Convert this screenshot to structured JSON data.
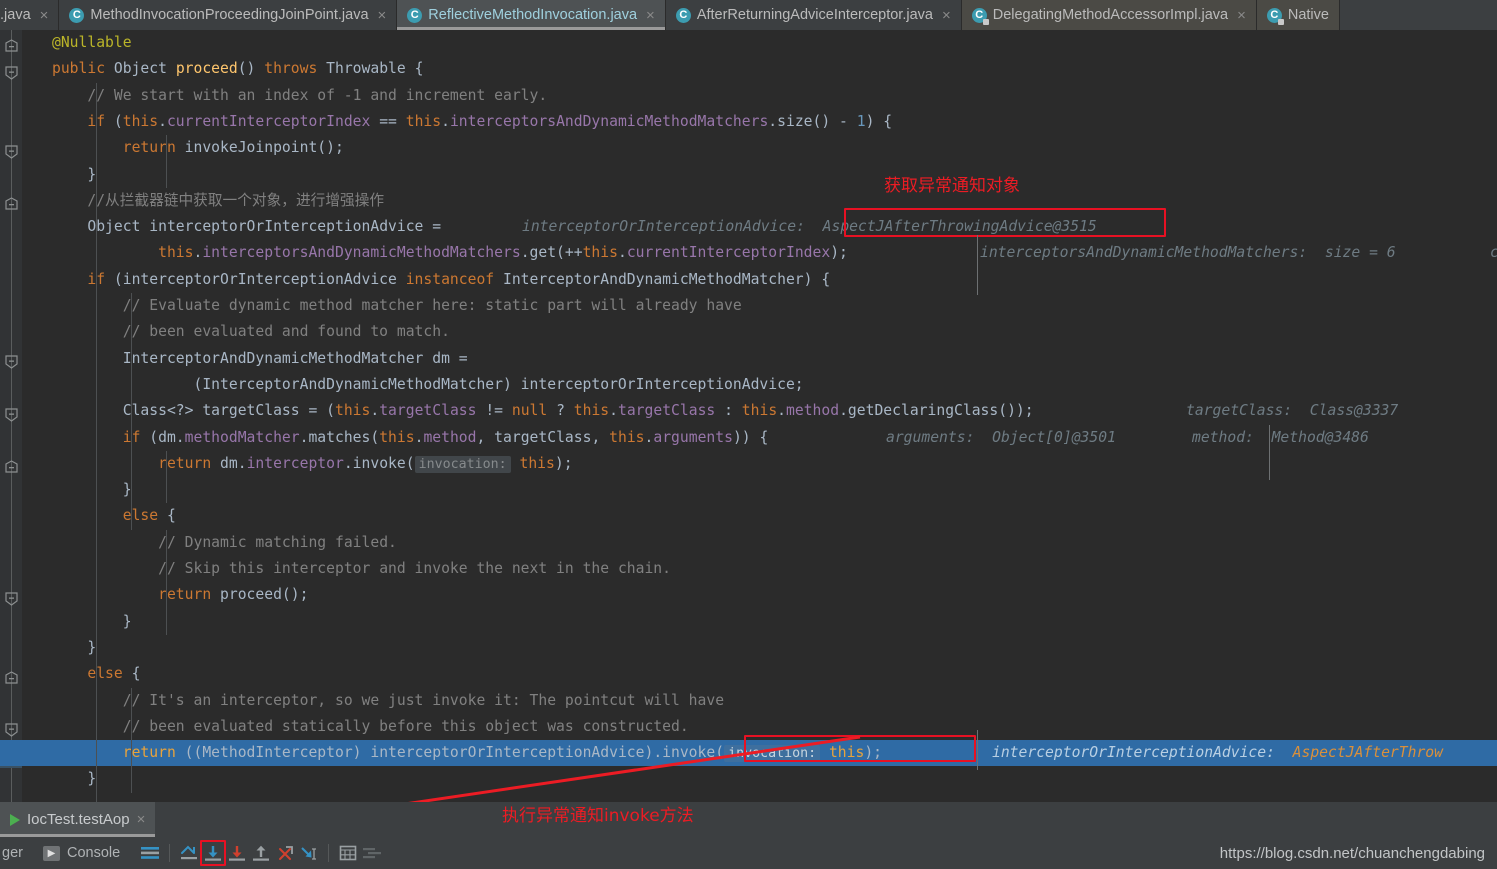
{
  "window": {
    "app": "IntelliJ IDEA Debugger",
    "watermark": "https://blog.csdn.net/chuanchengdabing"
  },
  "tabbar": {
    "tabs": [
      {
        "label": ".java",
        "icon": "",
        "state": "truncated",
        "closable": true
      },
      {
        "label": "MethodInvocationProceedingJoinPoint.java",
        "icon": "class-icon",
        "state": "normal",
        "closable": true
      },
      {
        "label": "ReflectiveMethodInvocation.java",
        "icon": "class-icon",
        "state": "active",
        "closable": true
      },
      {
        "label": "AfterReturningAdviceInterceptor.java",
        "icon": "class-icon",
        "state": "normal",
        "closable": true
      },
      {
        "label": "DelegatingMethodAccessorImpl.java",
        "icon": "class-icon-locked",
        "state": "readonly",
        "closable": true
      },
      {
        "label": "Native",
        "icon": "class-icon-locked",
        "state": "readonly",
        "closable": false
      }
    ],
    "close_glyph": "×"
  },
  "editor": {
    "language": "java",
    "lines": [
      {
        "n": 1,
        "indent": 0,
        "segments": [
          {
            "t": "@Nullable",
            "c": "ann"
          }
        ]
      },
      {
        "n": 2,
        "indent": 0,
        "segments": [
          {
            "t": "public",
            "c": "kw"
          },
          {
            "t": " ",
            "c": "id"
          },
          {
            "t": "Object",
            "c": "type"
          },
          {
            "t": " ",
            "c": "id"
          },
          {
            "t": "proceed",
            "c": "fn"
          },
          {
            "t": "() ",
            "c": "id"
          },
          {
            "t": "throws",
            "c": "kw"
          },
          {
            "t": " Throwable {",
            "c": "id"
          }
        ]
      },
      {
        "n": 3,
        "indent": 1,
        "segments": [
          {
            "t": "// We start with an index of -1 and increment early.",
            "c": "cmt"
          }
        ]
      },
      {
        "n": 4,
        "indent": 1,
        "segments": [
          {
            "t": "if",
            "c": "kw"
          },
          {
            "t": " (",
            "c": "id"
          },
          {
            "t": "this",
            "c": "kw"
          },
          {
            "t": ".",
            "c": "id"
          },
          {
            "t": "currentInterceptorIndex",
            "c": "fld"
          },
          {
            "t": " == ",
            "c": "id"
          },
          {
            "t": "this",
            "c": "kw"
          },
          {
            "t": ".",
            "c": "id"
          },
          {
            "t": "interceptorsAndDynamicMethodMatchers",
            "c": "fld"
          },
          {
            "t": ".size() - ",
            "c": "id"
          },
          {
            "t": "1",
            "c": "num"
          },
          {
            "t": ") {",
            "c": "id"
          }
        ]
      },
      {
        "n": 5,
        "indent": 2,
        "segments": [
          {
            "t": "return",
            "c": "kw"
          },
          {
            "t": " invokeJoinpoint();",
            "c": "id"
          }
        ]
      },
      {
        "n": 6,
        "indent": 1,
        "segments": [
          {
            "t": "}",
            "c": "id"
          }
        ]
      },
      {
        "n": 7,
        "indent": 1,
        "segments": [
          {
            "t": "//从拦截器链中获取一个对象，进行增强操作",
            "c": "cmt"
          }
        ]
      },
      {
        "n": 8,
        "indent": 1,
        "segments": [
          {
            "t": "Object",
            "c": "type"
          },
          {
            "t": " interceptorOrInterceptionAdvice =",
            "c": "id"
          }
        ],
        "inline_hints": [
          {
            "label": "interceptorOrInterceptionAdvice:",
            "value": "AspectJAfterThrowingAdvice@3515",
            "boxed": true
          }
        ]
      },
      {
        "n": 9,
        "indent": 3,
        "segments": [
          {
            "t": "this",
            "c": "kw"
          },
          {
            "t": ".",
            "c": "id"
          },
          {
            "t": "interceptorsAndDynamicMethodMatchers",
            "c": "fld"
          },
          {
            "t": ".get(++",
            "c": "id"
          },
          {
            "t": "this",
            "c": "kw"
          },
          {
            "t": ".",
            "c": "id"
          },
          {
            "t": "currentInterceptorIndex",
            "c": "fld"
          },
          {
            "t": ");",
            "c": "id"
          }
        ],
        "inline_hints": [
          {
            "label": "interceptorsAndDynamicMethodMatchers:",
            "value": "size = 6",
            "boxed": false
          },
          {
            "label": "c",
            "value": "",
            "boxed": false
          }
        ]
      },
      {
        "n": 10,
        "indent": 1,
        "segments": [
          {
            "t": "if",
            "c": "kw"
          },
          {
            "t": " (interceptorOrInterceptionAdvice ",
            "c": "id"
          },
          {
            "t": "instanceof",
            "c": "kw"
          },
          {
            "t": " InterceptorAndDynamicMethodMatcher) {",
            "c": "id"
          }
        ]
      },
      {
        "n": 11,
        "indent": 2,
        "segments": [
          {
            "t": "// Evaluate dynamic method matcher here: static part will already have",
            "c": "cmt"
          }
        ]
      },
      {
        "n": 12,
        "indent": 2,
        "segments": [
          {
            "t": "// been evaluated and found to match.",
            "c": "cmt"
          }
        ]
      },
      {
        "n": 13,
        "indent": 2,
        "segments": [
          {
            "t": "InterceptorAndDynamicMethodMatcher dm =",
            "c": "id"
          }
        ]
      },
      {
        "n": 14,
        "indent": 4,
        "segments": [
          {
            "t": "(InterceptorAndDynamicMethodMatcher) interceptorOrInterceptionAdvice;",
            "c": "id"
          }
        ]
      },
      {
        "n": 15,
        "indent": 2,
        "segments": [
          {
            "t": "Class<?> targetClass = (",
            "c": "id"
          },
          {
            "t": "this",
            "c": "kw"
          },
          {
            "t": ".",
            "c": "id"
          },
          {
            "t": "targetClass",
            "c": "fld"
          },
          {
            "t": " != ",
            "c": "id"
          },
          {
            "t": "null",
            "c": "kw"
          },
          {
            "t": " ? ",
            "c": "id"
          },
          {
            "t": "this",
            "c": "kw"
          },
          {
            "t": ".",
            "c": "id"
          },
          {
            "t": "targetClass",
            "c": "fld"
          },
          {
            "t": " : ",
            "c": "id"
          },
          {
            "t": "this",
            "c": "kw"
          },
          {
            "t": ".",
            "c": "id"
          },
          {
            "t": "method",
            "c": "fld"
          },
          {
            "t": ".getDeclaringClass());",
            "c": "id"
          }
        ],
        "inline_hints": [
          {
            "label": "targetClass:",
            "value": "Class@3337",
            "boxed": false
          }
        ]
      },
      {
        "n": 16,
        "indent": 2,
        "segments": [
          {
            "t": "if",
            "c": "kw"
          },
          {
            "t": " (dm.",
            "c": "id"
          },
          {
            "t": "methodMatcher",
            "c": "fld"
          },
          {
            "t": ".matches(",
            "c": "id"
          },
          {
            "t": "this",
            "c": "kw"
          },
          {
            "t": ".",
            "c": "id"
          },
          {
            "t": "method",
            "c": "fld"
          },
          {
            "t": ", targetClass, ",
            "c": "id"
          },
          {
            "t": "this",
            "c": "kw"
          },
          {
            "t": ".",
            "c": "id"
          },
          {
            "t": "arguments",
            "c": "fld"
          },
          {
            "t": ")) {",
            "c": "id"
          }
        ],
        "inline_hints": [
          {
            "label": "arguments:",
            "value": "Object[0]@3501",
            "boxed": false
          },
          {
            "label": "method:",
            "value": "Method@3486",
            "boxed": false
          }
        ]
      },
      {
        "n": 17,
        "indent": 3,
        "segments": [
          {
            "t": "return",
            "c": "kw"
          },
          {
            "t": " dm.",
            "c": "id"
          },
          {
            "t": "interceptor",
            "c": "fld"
          },
          {
            "t": ".invoke(",
            "c": "id"
          },
          {
            "t": "@@PARAM:invocation:@@",
            "c": "param"
          },
          {
            "t": " ",
            "c": "id"
          },
          {
            "t": "this",
            "c": "kw"
          },
          {
            "t": ");",
            "c": "id"
          }
        ]
      },
      {
        "n": 18,
        "indent": 2,
        "segments": [
          {
            "t": "}",
            "c": "id"
          }
        ]
      },
      {
        "n": 19,
        "indent": 2,
        "segments": [
          {
            "t": "else",
            "c": "kw"
          },
          {
            "t": " {",
            "c": "id"
          }
        ]
      },
      {
        "n": 20,
        "indent": 3,
        "segments": [
          {
            "t": "// Dynamic matching failed.",
            "c": "cmt"
          }
        ]
      },
      {
        "n": 21,
        "indent": 3,
        "segments": [
          {
            "t": "// Skip this interceptor and invoke the next in the chain.",
            "c": "cmt"
          }
        ]
      },
      {
        "n": 22,
        "indent": 3,
        "segments": [
          {
            "t": "return",
            "c": "kw"
          },
          {
            "t": " proceed();",
            "c": "id"
          }
        ]
      },
      {
        "n": 23,
        "indent": 2,
        "segments": [
          {
            "t": "}",
            "c": "id"
          }
        ]
      },
      {
        "n": 24,
        "indent": 1,
        "segments": [
          {
            "t": "}",
            "c": "id"
          }
        ]
      },
      {
        "n": 25,
        "indent": 1,
        "segments": [
          {
            "t": "else",
            "c": "kw"
          },
          {
            "t": " {",
            "c": "id"
          }
        ]
      },
      {
        "n": 26,
        "indent": 2,
        "segments": [
          {
            "t": "// It's an interceptor, so we just invoke it: The pointcut will have",
            "c": "cmt"
          }
        ]
      },
      {
        "n": 27,
        "indent": 2,
        "segments": [
          {
            "t": "// been evaluated statically before this object was constructed.",
            "c": "cmt"
          }
        ]
      },
      {
        "n": 28,
        "indent": 2,
        "highlight": true,
        "segments": [
          {
            "t": "return",
            "c": "kw"
          },
          {
            "t": " ((MethodInterceptor) interceptorOrInterceptionAdvice).invoke(",
            "c": "id"
          },
          {
            "t": "@@PARAM:invocation:@@",
            "c": "param"
          },
          {
            "t": " ",
            "c": "id"
          },
          {
            "t": "this",
            "c": "kw"
          },
          {
            "t": ");",
            "c": "id"
          }
        ],
        "inline_hints": [
          {
            "label": "interceptorOrInterceptionAdvice:",
            "value": "AspectJAfterThrow",
            "boxed": false
          }
        ]
      },
      {
        "n": 29,
        "indent": 1,
        "segments": [
          {
            "t": "}",
            "c": "id"
          }
        ]
      }
    ]
  },
  "annotations": [
    {
      "id": "note-top",
      "text": "获取异常通知对象",
      "color": "#ec1c24"
    },
    {
      "id": "note-bottom",
      "text": "执行异常通知invoke方法",
      "color": "#ec1c24"
    }
  ],
  "run_panel": {
    "tab_label": "IocTest.testAop",
    "close_glyph": "×"
  },
  "statusbar": {
    "debugger_label": "ger",
    "console_label": "Console",
    "console_icon": "terminal-icon",
    "tools": [
      {
        "name": "show-execution-point-icon",
        "title": "Show Execution Point"
      },
      {
        "name": "step-over-icon",
        "title": "Step Over"
      },
      {
        "name": "step-into-icon",
        "title": "Step Into",
        "highlighted": true
      },
      {
        "name": "force-step-into-icon",
        "title": "Force Step Into"
      },
      {
        "name": "step-out-icon",
        "title": "Step Out"
      },
      {
        "name": "drop-frame-icon",
        "title": "Drop Frame"
      },
      {
        "name": "run-to-cursor-icon",
        "title": "Run to Cursor"
      },
      {
        "name": "evaluate-expression-icon",
        "title": "Evaluate Expression"
      },
      {
        "name": "settings-lines-icon",
        "title": "Layout Settings"
      }
    ]
  }
}
